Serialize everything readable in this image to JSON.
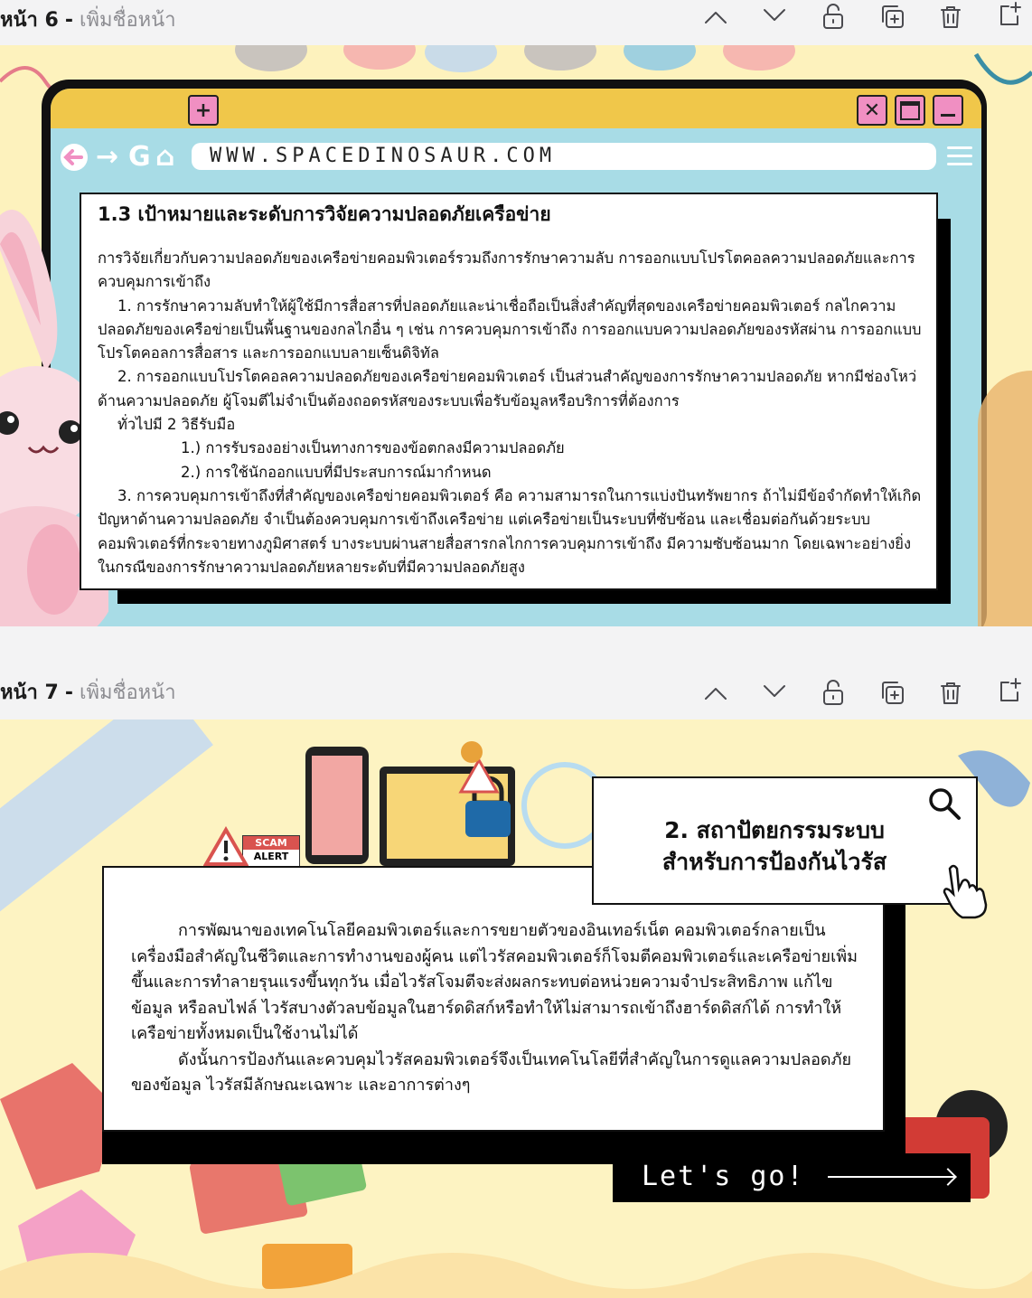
{
  "pages": [
    {
      "page_label": "หน้า 6",
      "separator": "-",
      "name_placeholder": "เพิ่มชื่อหน้า",
      "slide": {
        "url": "WWW.SPACEDINOSAUR.COM",
        "heading": "1.3  เป้าหมายและระดับการวิจัยความปลอดภัยเครือข่าย",
        "paragraphs": [
          "การวิจัยเกี่ยวกับความปลอดภัยของเครือข่ายคอมพิวเตอร์รวมถึงการรักษาความลับ  การออกแบบโปรโตคอลความปลอดภัยและการควบคุมการเข้าถึง",
          "1.  การรักษาความลับทำให้ผู้ใช้มีการสื่อสารที่ปลอดภัยและน่าเชื่อถือเป็นสิ่งสำคัญที่สุดของเครือข่ายคอมพิวเตอร์  กลไกความปลอดภัยของเครือข่ายเป็นพื้นฐานของกลไกอื่น  ๆ  เช่น  การควบคุมการเข้าถึง  การออกแบบความปลอดภัยของรหัสผ่าน  การออกแบบโปรโตคอลการสื่อสาร  และการออกแบบลายเซ็นดิจิทัล",
          "2.  การออกแบบโปรโตคอลความปลอดภัยของเครือข่ายคอมพิวเตอร์  เป็นส่วนสำคัญของการรักษาความปลอดภัย  หากมีช่องโหว่ด้านความปลอดภัย  ผู้โจมตีไม่จำเป็นต้องถอดรหัสของระบบเพื่อรับข้อมูลหรือบริการที่ต้องการ",
          "ทั่วไปมี  2  วิธีรับมือ",
          "1.)  การรับรองอย่างเป็นทางการของข้อตกลงมีความปลอดภัย",
          "2.)  การใช้นักออกแบบที่มีประสบการณ์มากำหนด",
          "3.  การควบคุมการเข้าถึงที่สำคัญของเครือข่ายคอมพิวเตอร์  คือ  ความสามารถในการแบ่งปันทรัพยากร  ถ้าไม่มีข้อจำกัดทำให้เกิดปัญหาด้านความปลอดภัย  จำเป็นต้องควบคุมการเข้าถึงเครือข่าย  แต่เครือข่ายเป็นระบบที่ซับซ้อน  และเชื่อมต่อกันด้วยระบบคอมพิวเตอร์ที่กระจายทางภูมิศาสตร์  บางระบบผ่านสายสื่อสารกลไกการควบคุมการเข้าถึง  มีความซับซ้อนมาก  โดยเฉพาะอย่างยิ่งในกรณีของการรักษาความปลอดภัยหลายระดับที่มีความปลอดภัยสูง"
        ]
      }
    },
    {
      "page_label": "หน้า 7",
      "separator": "-",
      "name_placeholder": "เพิ่มชื่อหน้า",
      "slide": {
        "title_line1": "2.  สถาปัตยกรรมระบบ",
        "title_line2": "สำหรับการป้องกันไวรัส",
        "paragraphs": [
          "การพัฒนาของเทคโนโลยีคอมพิวเตอร์และการขยายตัวของอินเทอร์เน็ต  คอมพิวเตอร์กลายเป็นเครื่องมือสำคัญในชีวิตและการทำงานของผู้คน  แต่ไวรัสคอมพิวเตอร์ก็โจมตีคอมพิวเตอร์และเครือข่ายเพิ่มขึ้นและการทำลายรุนแรงขึ้นทุกวัน  เมื่อไวรัสโจมตีจะส่งผลกระทบต่อหน่วยความจำประสิทธิภาพ  แก้ไขข้อมูล  หรือลบไฟล์  ไวรัสบางตัวลบข้อมูลในฮาร์ดดิสก์หรือทำให้ไม่สามารถเข้าถึงฮาร์ดดิสก์ได้  การทำให้เครือข่ายทั้งหมดเป็นใช้งานไม่ได้",
          "ดังนั้นการป้องกันและควบคุมไวรัสคอมพิวเตอร์จึงเป็นเทคโนโลยีที่สำคัญในการดูแลความปลอดภัยของข้อมูล  ไวรัสมีลักษณะเฉพาะ  และอาการต่างๆ"
        ],
        "cta": "Let's go!",
        "scam_badge": [
          "SCAM",
          "ALERT"
        ]
      }
    }
  ],
  "toolbar_icons": [
    "chevron-up-icon",
    "chevron-down-icon",
    "unlock-icon",
    "duplicate-icon",
    "trash-icon",
    "add-page-icon"
  ],
  "colors": {
    "slide_bg": "#fdf2bd",
    "browser_blue": "#a8dce6",
    "tab_yellow": "#f0c74a",
    "button_pink": "#f08fc2"
  }
}
